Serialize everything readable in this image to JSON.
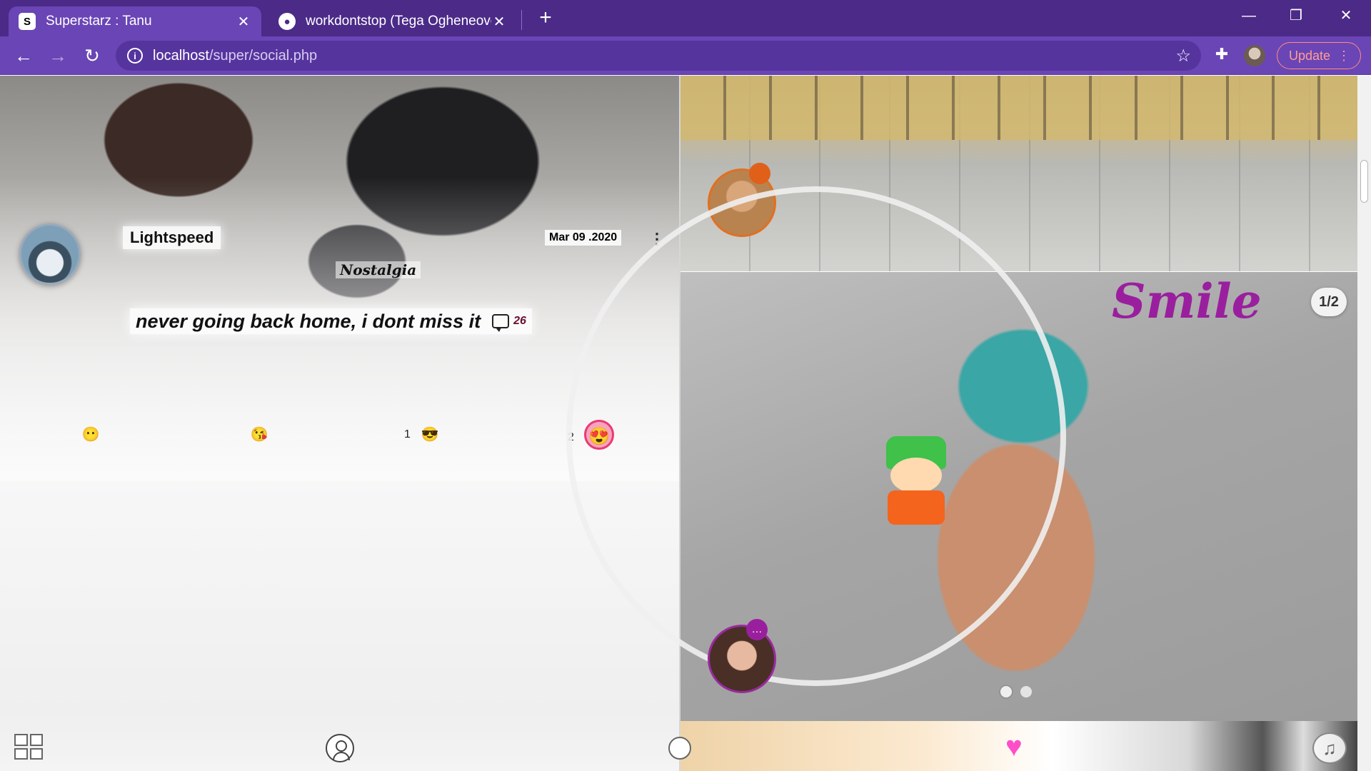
{
  "browser": {
    "tabs": [
      {
        "title": "Superstarz : Tanu",
        "favicon": "S",
        "active": true
      },
      {
        "title": "workdontstop (Tega Ogheneovo)",
        "favicon": "github-icon",
        "active": false
      }
    ],
    "url_host": "localhost",
    "url_path": "/super/social.php",
    "update_label": "Update",
    "theme_color": "#6a45b5"
  },
  "post_left": {
    "author": "Lightspeed",
    "date": "Mar 09 .2020",
    "tag": "Nostalgia",
    "caption": "never going back home, i dont miss it",
    "comment_count": "26",
    "reactions": [
      {
        "emoji": "😶",
        "count": ""
      },
      {
        "emoji": "😘",
        "count": ""
      },
      {
        "emoji": "😎",
        "count": "1"
      },
      {
        "emoji": "😍",
        "count": "2",
        "active": true
      }
    ]
  },
  "post_right": {
    "title": "Smile",
    "page_indicator": "1/2",
    "slides_total": 2,
    "slide_active": 1,
    "title_color": "#9a1f9e"
  },
  "bottom_nav": {
    "items": [
      "grid-icon",
      "user-icon",
      "home-icon",
      "heart-icon",
      "music-icon"
    ],
    "accent": "#ff4fc8"
  }
}
